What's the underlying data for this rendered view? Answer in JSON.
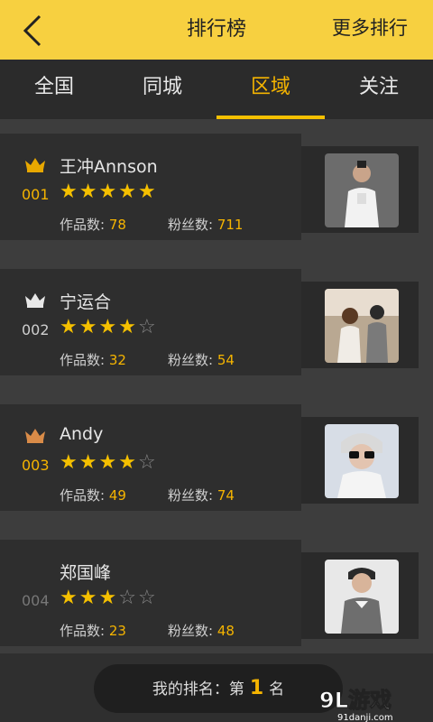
{
  "header": {
    "title": "排行榜",
    "more_label": "更多排行"
  },
  "tabs": [
    {
      "label": "全国"
    },
    {
      "label": "同城"
    },
    {
      "label": "区域"
    },
    {
      "label": "关注"
    }
  ],
  "active_tab": "区域",
  "list": [
    {
      "rank": "001",
      "crown": "gold-crown-icon",
      "name": "王冲Annson",
      "stars": 5,
      "works_label": "作品数",
      "works": "78",
      "fans_label": "粉丝数",
      "fans": "711"
    },
    {
      "rank": "002",
      "crown": "silver-crown-icon",
      "name": "宁运合",
      "stars": 4,
      "works_label": "作品数",
      "works": "32",
      "fans_label": "粉丝数",
      "fans": "54"
    },
    {
      "rank": "003",
      "crown": "bronze-crown-icon",
      "name": "Andy",
      "stars": 4,
      "works_label": "作品数",
      "works": "49",
      "fans_label": "粉丝数",
      "fans": "74"
    },
    {
      "rank": "004",
      "crown": "",
      "name": "郑国峰",
      "stars": 3,
      "works_label": "作品数",
      "works": "23",
      "fans_label": "粉丝数",
      "fans": "48"
    }
  ],
  "bottom": {
    "my_rank_prefix": "我的排名：第",
    "my_rank_value": "1",
    "my_rank_suffix": "名"
  },
  "watermark": {
    "logo_text": "9L游戏",
    "site": "91danji.com"
  },
  "colors": {
    "accent": "#f5c000",
    "header_bg": "#f7d040",
    "rank_text": "#f5b400"
  }
}
